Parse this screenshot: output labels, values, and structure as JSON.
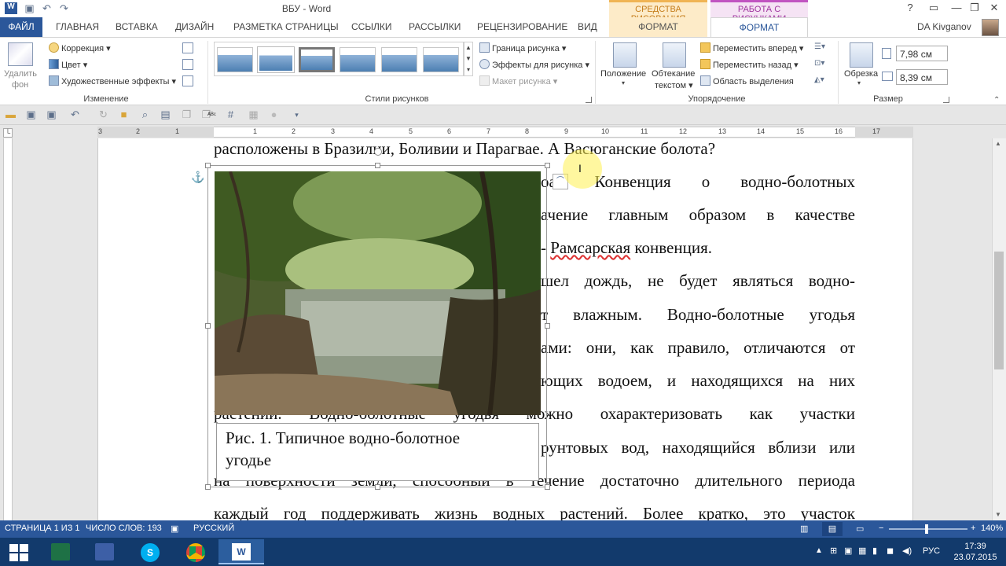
{
  "window": {
    "title": "ВБУ - Word",
    "ctx_drawing": "СРЕДСТВА РИСОВАНИЯ",
    "ctx_picture": "РАБОТА С РИСУНКАМИ",
    "help": "?",
    "ribbon_opts": "▭",
    "minimize": "—",
    "restore": "❐",
    "close": "✕"
  },
  "tabs": {
    "file": "ФАЙЛ",
    "home": "ГЛАВНАЯ",
    "insert": "ВСТАВКА",
    "design": "ДИЗАЙН",
    "layout": "РАЗМЕТКА СТРАНИЦЫ",
    "refs": "ССЫЛКИ",
    "mailings": "РАССЫЛКИ",
    "review": "РЕЦЕНЗИРОВАНИЕ",
    "view": "ВИД",
    "draw_format": "ФОРМАТ",
    "pic_format": "ФОРМАТ",
    "user": "DA Kivganov"
  },
  "ribbon": {
    "remove_bg_1": "Удалить",
    "remove_bg_2": "фон",
    "correction": "Коррекция ▾",
    "color": "Цвет ▾",
    "art_effects": "Художественные эффекты ▾",
    "group_adjust": "Изменение",
    "group_styles": "Стили рисунков",
    "border": "Граница рисунка ▾",
    "effects": "Эффекты для рисунка ▾",
    "layout": "Макет рисунка ▾",
    "position_1": "Положение",
    "wrap_1": "Обтекание",
    "wrap_2": "текстом ▾",
    "bring_forward": "Переместить вперед ▾",
    "send_backward": "Переместить назад ▾",
    "selection_pane": "Область выделения",
    "group_arrange": "Упорядочение",
    "crop": "Обрезка",
    "height": "7,98 см",
    "width": "8,39 см",
    "group_size": "Размер"
  },
  "ruler": [
    "3",
    "2",
    "1",
    "1",
    "2",
    "3",
    "4",
    "5",
    "6",
    "7",
    "8",
    "9",
    "10",
    "11",
    "12",
    "13",
    "14",
    "15",
    "16",
    "17"
  ],
  "document": {
    "l1": "расположены в Бразилии, Боливии и Парагвае. А Васюганские болота?",
    "l2": "ая Конвенция о водно-болотных",
    "l2_pre": "о",
    "l3": "ачение главным образом в качестве",
    "l4_pre": "-",
    "l4_ramsar": "Рамсарская",
    "l4_post": " конвенция.",
    "l5": "шел дождь, не будет являться водно-",
    "l6": "т влажным. Водно-болотные угодья",
    "l7": "ами: они, как правило, отличаются от",
    "l8": "ющих водоем, и находящихся на них",
    "l9": "растений. Водно-болотные угодья можно охарактеризовать как участки",
    "l10": "рунтовых вод, находящийся вблизи или",
    "l11": "на поверхности земли, способный в течение достаточно длительного периода",
    "l12": "каждый год поддерживать жизнь водных растений. Более кратко, это участок",
    "caption_1": "Рис. 1. Типичное водно-болотное",
    "caption_2": "угодье"
  },
  "status": {
    "page": "СТРАНИЦА 1 ИЗ 1",
    "words": "ЧИСЛО СЛОВ: 193",
    "lang": "РУССКИЙ",
    "zoom_minus": "−",
    "zoom_plus": "+",
    "zoom": "140%"
  },
  "taskbar": {
    "lang": "РУС",
    "time": "17:39",
    "date": "23.07.2015"
  }
}
